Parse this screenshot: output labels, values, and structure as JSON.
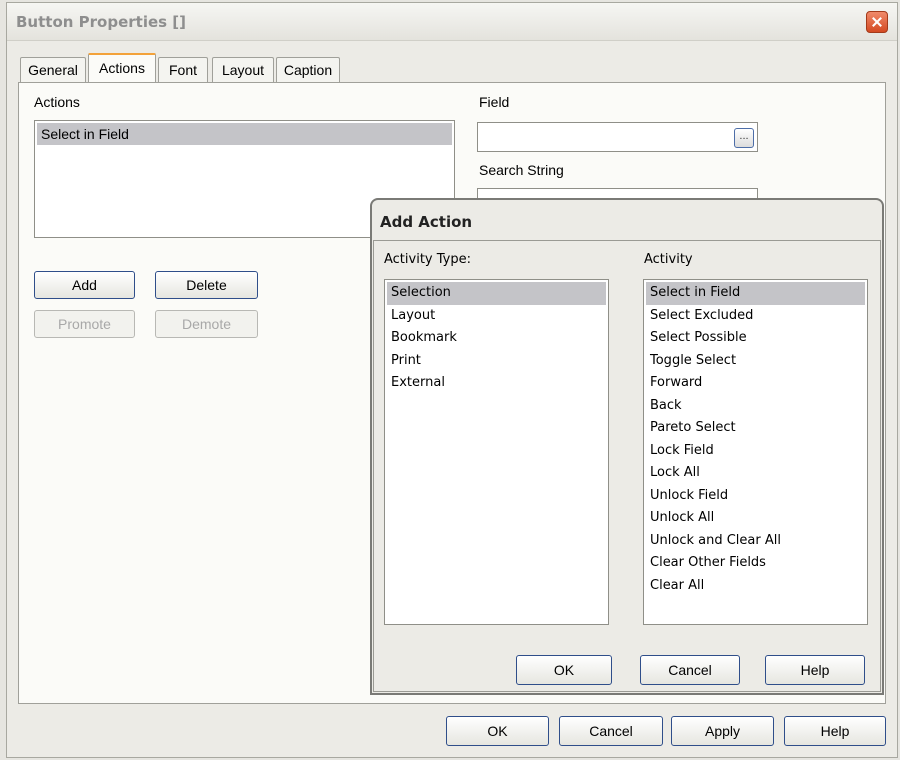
{
  "window": {
    "title": "Button Properties []"
  },
  "tabs": [
    {
      "label": "General"
    },
    {
      "label": "Actions",
      "active": true
    },
    {
      "label": "Font"
    },
    {
      "label": "Layout"
    },
    {
      "label": "Caption"
    }
  ],
  "actions_panel": {
    "label": "Actions",
    "items": [
      "Select in Field"
    ],
    "selected": "Select in Field",
    "add_label": "Add",
    "delete_label": "Delete",
    "promote_label": "Promote",
    "demote_label": "Demote"
  },
  "field_panel": {
    "field_label": "Field",
    "field_value": "",
    "browse_label": "...",
    "search_label": "Search String"
  },
  "add_action_dialog": {
    "title": "Add Action",
    "activity_type_label": "Activity Type:",
    "activity_types": [
      "Selection",
      "Layout",
      "Bookmark",
      "Print",
      "External"
    ],
    "selected_type": "Selection",
    "activity_label": "Activity",
    "activities": [
      "Select in Field",
      "Select Excluded",
      "Select Possible",
      "Toggle Select",
      "Forward",
      "Back",
      "Pareto Select",
      "Lock Field",
      "Lock All",
      "Unlock Field",
      "Unlock All",
      "Unlock and Clear All",
      "Clear Other Fields",
      "Clear All"
    ],
    "selected_activity": "Select in Field",
    "ok_label": "OK",
    "cancel_label": "Cancel",
    "help_label": "Help"
  },
  "footer": {
    "ok_label": "OK",
    "cancel_label": "Cancel",
    "apply_label": "Apply",
    "help_label": "Help"
  },
  "colors": {
    "active_tab_accent": "#f3a23a",
    "selection": "#c4c4c8",
    "button_border": "#2f4e8a",
    "close_button": "#d44a22"
  }
}
